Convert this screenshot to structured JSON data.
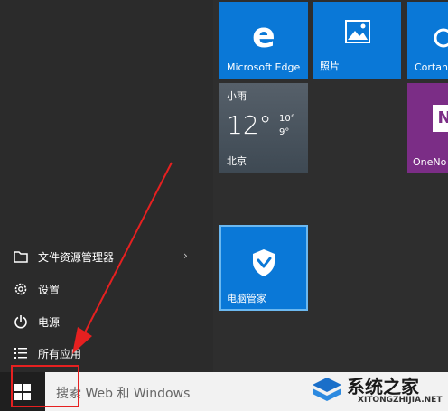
{
  "start_menu": {
    "left_menu": {
      "file_explorer": "文件资源管理器",
      "settings": "设置",
      "power": "电源",
      "all_apps": "所有应用"
    },
    "tiles": {
      "edge": "Microsoft Edge",
      "photos": "照片",
      "cortana": "Cortan",
      "onenote": "OneNo",
      "tencent": "电脑管家"
    },
    "weather": {
      "city": "小雨",
      "temp": "12°",
      "high": "10°",
      "low": "9°",
      "location": "北京"
    }
  },
  "taskbar": {
    "search_placeholder": "搜索 Web 和 Windows"
  },
  "watermark": {
    "title": "系统之家",
    "url": "XITONGZHIJIA.NET"
  },
  "colors": {
    "tile_blue": "#0a78d7",
    "onenote_purple": "#7b2d86",
    "annotation_red": "#e62020"
  },
  "icons": [
    "edge-icon",
    "photos-icon",
    "onenote-icon",
    "tencent-shield-icon",
    "folder-icon",
    "gear-icon",
    "power-icon",
    "list-icon",
    "windows-logo-icon",
    "chevron-right-icon"
  ]
}
